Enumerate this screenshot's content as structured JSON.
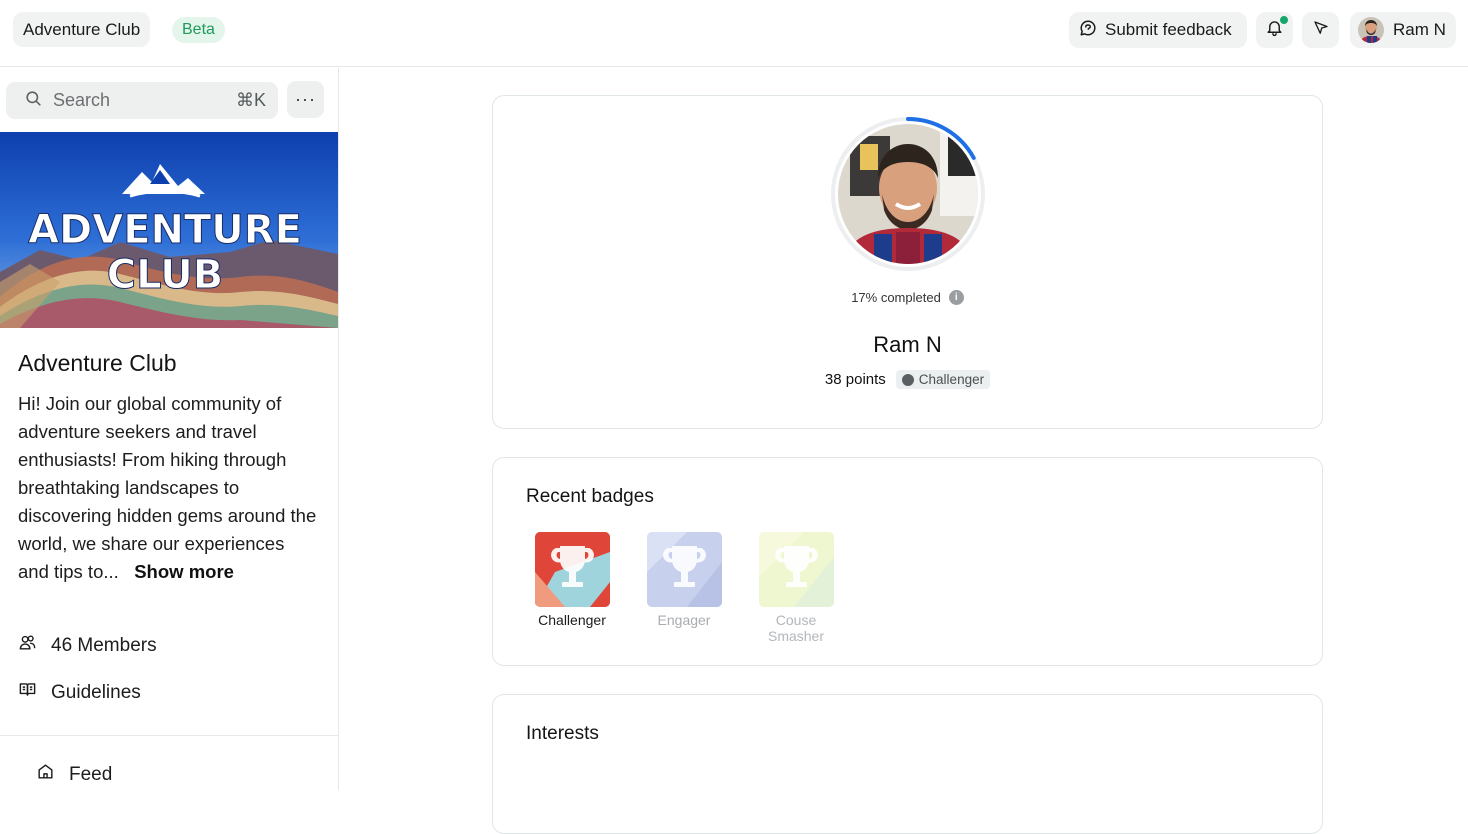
{
  "topbar": {
    "community_name": "Adventure Club",
    "beta_label": "Beta",
    "feedback_label": "Submit feedback",
    "user_name": "Ram N",
    "icons": [
      "chat-bubble-icon",
      "bell-icon",
      "send-arrow-icon"
    ],
    "notification_dot_color": "#18a56b"
  },
  "sidebar": {
    "search_placeholder": "Search",
    "search_shortcut": "⌘K",
    "more_label": "···",
    "banner_text_line1": "ADVENTURE",
    "banner_text_line2": "CLUB",
    "community_title": "Adventure Club",
    "description": "Hi! Join our global community of adventure seekers and travel enthusiasts! From hiking through breathtaking landscapes to discovering hidden gems around the world, we share our experiences and tips to...",
    "show_more_label": "Show more",
    "members_label": "46 Members",
    "guidelines_label": "Guidelines",
    "feed_label": "Feed"
  },
  "profile": {
    "progress_percent": 17,
    "progress_label": "17% completed",
    "info_label": "i",
    "name": "Ram N",
    "points_label": "38 points",
    "level_label": "Challenger",
    "progress_color": "#1f6fe5"
  },
  "badges": {
    "title": "Recent badges",
    "items": [
      {
        "label": "Challenger",
        "earned": true
      },
      {
        "label": "Engager",
        "earned": false
      },
      {
        "label": "Couse Smasher",
        "earned": false
      }
    ]
  },
  "interests": {
    "title": "Interests"
  }
}
